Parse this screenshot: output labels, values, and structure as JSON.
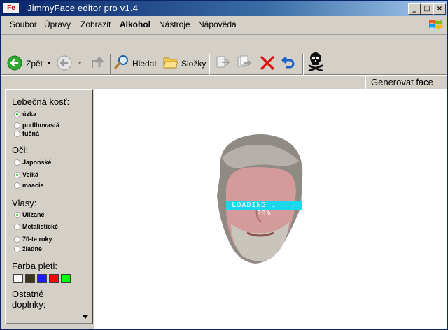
{
  "window": {
    "title": "JimmyFace editor pro v1.4",
    "app_icon": "Fe",
    "buttons": {
      "minimize": "_",
      "maximize": "□",
      "close": "×"
    }
  },
  "menu": {
    "items": [
      {
        "label": "Soubor"
      },
      {
        "label": "Úpravy"
      },
      {
        "label": "Zobrazit"
      },
      {
        "label": "Alkohol"
      },
      {
        "label": "Nástroje"
      },
      {
        "label": "Nápověda"
      }
    ]
  },
  "toolbar": {
    "back_label": "Zpět",
    "search_label": "Hledat",
    "folders_label": "Složky",
    "icons": [
      "back-arrow-icon",
      "forward-arrow-icon",
      "up-folder-icon",
      "search-icon",
      "folders-icon",
      "move-to-icon",
      "copy-to-icon",
      "delete-icon",
      "undo-icon",
      "skull-icon"
    ]
  },
  "status": {
    "generate_label": "Generovat face"
  },
  "sidebar": {
    "skull": {
      "title": "Lebečná kosť:",
      "options": [
        {
          "label": "úzka",
          "checked": true
        },
        {
          "label": "podlhovastá",
          "checked": false
        },
        {
          "label": "tučná",
          "checked": false
        }
      ]
    },
    "eyes": {
      "title": "Oči:",
      "options": [
        {
          "label": "Japonské",
          "checked": false
        },
        {
          "label": "Velká",
          "checked": true
        },
        {
          "label": "maacie",
          "checked": false
        }
      ]
    },
    "hair": {
      "title": "Vlasy:",
      "options": [
        {
          "label": "Ulízané",
          "checked": true
        },
        {
          "label": "Metalistické",
          "checked": false
        },
        {
          "label": "70-te roky",
          "checked": false
        },
        {
          "label": "žiadne",
          "checked": false
        }
      ]
    },
    "skin": {
      "title": "Farba pleti:",
      "swatches": [
        "#ffffff",
        "#3b3520",
        "#1c1cff",
        "#ff0000",
        "#00ff00"
      ]
    },
    "other_title_line1": "Ostatné",
    "other_title_line2": "doplnky:"
  },
  "canvas": {
    "loading_text": "LOADING . . . 20%",
    "loading_percent": 20
  },
  "colors": {
    "titlebar": "#0a246a",
    "chrome": "#d4d0c8",
    "loading_bar": "#1ad7ee"
  }
}
